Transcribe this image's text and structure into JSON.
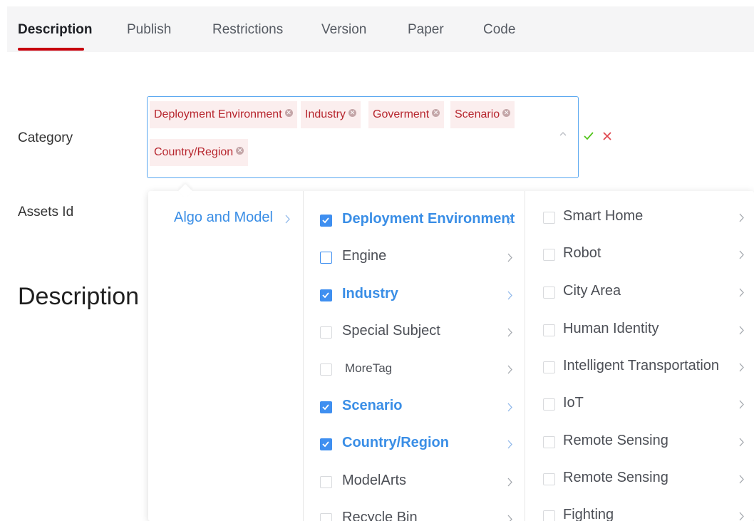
{
  "tabs": [
    {
      "label": "Description",
      "active": true
    },
    {
      "label": "Publish",
      "active": false
    },
    {
      "label": "Restrictions",
      "active": false
    },
    {
      "label": "Version",
      "active": false
    },
    {
      "label": "Paper",
      "active": false
    },
    {
      "label": "Code",
      "active": false
    }
  ],
  "form": {
    "category_label": "Category",
    "assets_id_label": "Assets Id",
    "section_title": "Description"
  },
  "selected_tags": [
    "Deployment Environment",
    "Industry",
    "Goverment",
    "Scenario",
    "Country/Region"
  ],
  "cascader": {
    "level1": [
      {
        "label": "Algo and Model",
        "active": true
      }
    ],
    "level2": [
      {
        "label": "Deployment Environment",
        "checked": true
      },
      {
        "label": "Engine",
        "checked": false
      },
      {
        "label": "Industry",
        "checked": true
      },
      {
        "label": "Special Subject",
        "checked": false
      },
      {
        "label": "MoreTag",
        "checked": false
      },
      {
        "label": "Scenario",
        "checked": true
      },
      {
        "label": "Country/Region",
        "checked": true
      },
      {
        "label": "ModelArts",
        "checked": false
      },
      {
        "label": "Recycle Bin",
        "checked": false
      }
    ],
    "level3": [
      {
        "label": "Smart Home",
        "checked": false
      },
      {
        "label": "Robot",
        "checked": false
      },
      {
        "label": "City Area",
        "checked": false
      },
      {
        "label": "Human Identity",
        "checked": false
      },
      {
        "label": "Intelligent Transportation",
        "checked": false
      },
      {
        "label": "IoT",
        "checked": false
      },
      {
        "label": "Remote Sensing",
        "checked": false
      },
      {
        "label": "Remote Sensing",
        "checked": false
      },
      {
        "label": "Fighting",
        "checked": false
      }
    ]
  },
  "colors": {
    "accent_red": "#c7000b",
    "tag_text": "#b7262e",
    "tag_bg": "#fbeeee",
    "primary_blue": "#3f8ff0",
    "confirm_green": "#52c41a",
    "cancel_red": "#e0474f"
  },
  "icons": {
    "tag_remove": "close-circle-icon",
    "collapse": "chevron-up-icon",
    "confirm": "check-icon",
    "cancel": "close-icon",
    "expand_child": "chevron-right-icon"
  }
}
